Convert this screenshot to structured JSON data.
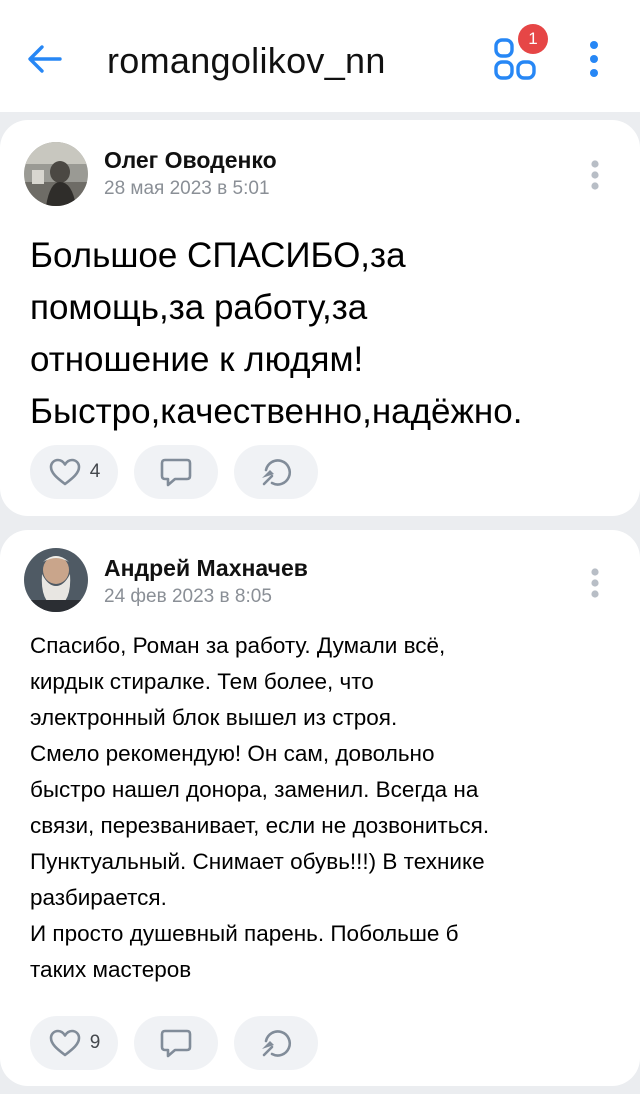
{
  "header": {
    "back_icon": "arrow-left-icon",
    "title": "romangolikov_nn",
    "apps_icon": "apps-grid-icon",
    "apps_badge": "1",
    "menu_icon": "vertical-dots-icon",
    "accent": "#2787f5",
    "badge_color": "#e64646"
  },
  "posts": [
    {
      "author": "Олег Оводенко",
      "date": "28 мая 2023 в 5:01",
      "text": "Большое СПАСИБО,за\nпомощь,за работу,за\nотношение к людям!\nБыстро,качественно,надёжно.",
      "likes": "4"
    },
    {
      "author": "Андрей Махначев",
      "date": "24 фев 2023 в 8:05",
      "text": "Спасибо, Роман за работу. Думали всё,\nкирдык стиралке. Тем более, что\nэлектронный блок вышел из строя.\n Смело рекомендую! Он сам, довольно\nбыстро нашел донора, заменил. Всегда на\nсвязи, перезванивает, если не дозвониться.\nПунктуальный. Снимает обувь!!!) В технике\nразбирается.\nИ просто душевный парень. Побольше б\nтаких мастеров",
      "likes": "9"
    }
  ]
}
